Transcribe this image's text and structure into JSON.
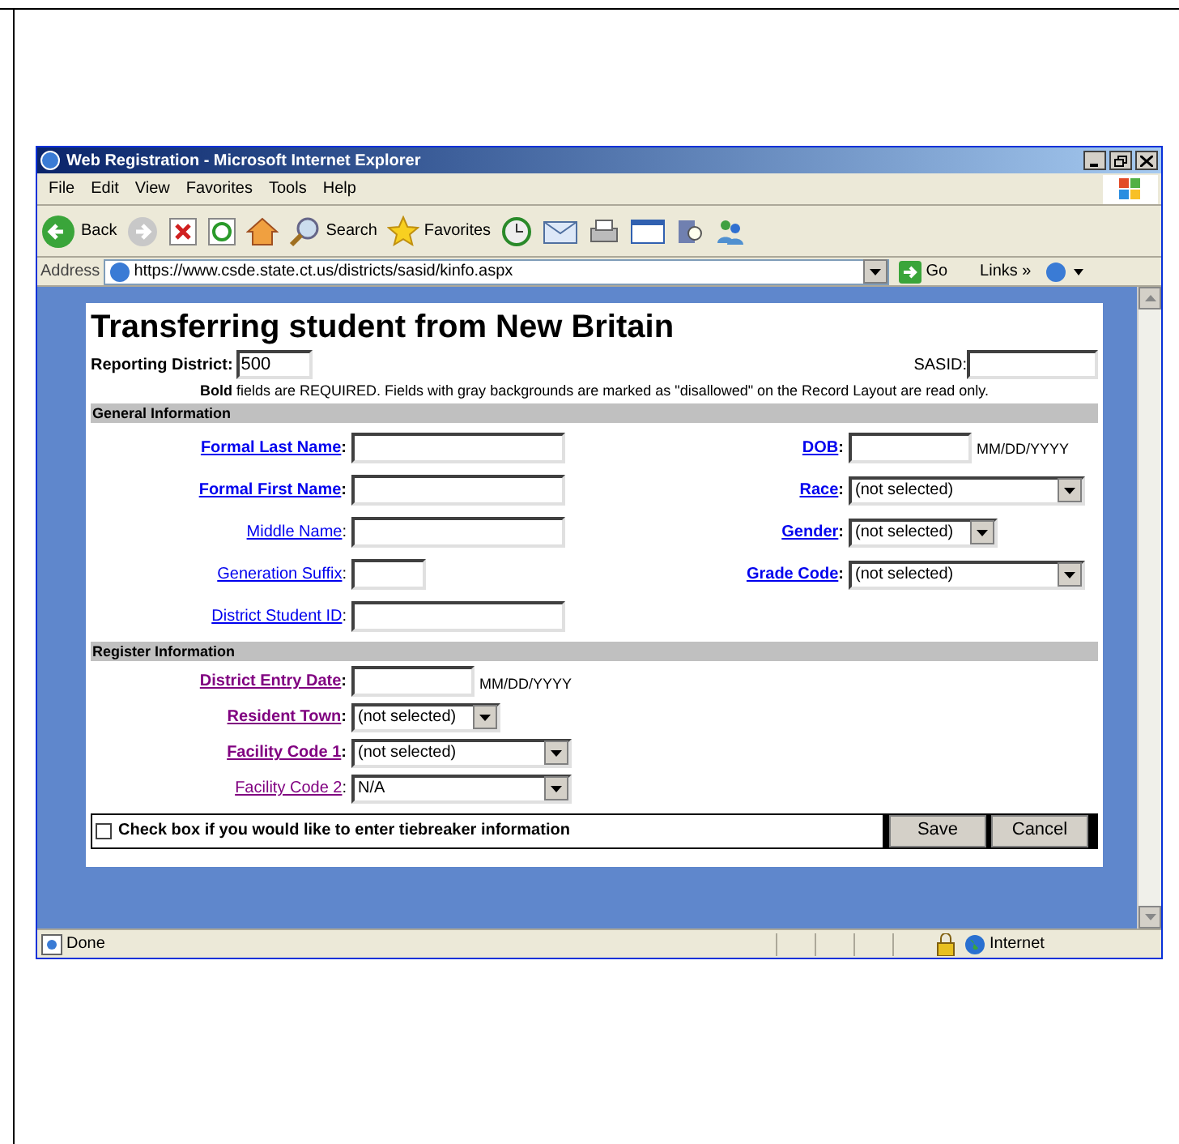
{
  "window": {
    "title": "Web Registration - Microsoft Internet Explorer"
  },
  "menu": [
    "File",
    "Edit",
    "View",
    "Favorites",
    "Tools",
    "Help"
  ],
  "toolbar": {
    "back": "Back",
    "search": "Search",
    "favorites": "Favorites"
  },
  "address": {
    "label": "Address",
    "url": "https://www.csde.state.ct.us/districts/sasid/kinfo.aspx",
    "go": "Go",
    "links": "Links",
    "chevron": "»"
  },
  "page": {
    "title": "Transferring student from New Britain",
    "reporting_district": {
      "label": "Reporting District:",
      "value": "500"
    },
    "sasid": {
      "label": "SASID:"
    },
    "note": "**Bold** fields are REQUIRED. Fields with gray backgrounds are marked as \"disallowed\" on the Record Layout are read only.",
    "sections": [
      {
        "title": "General Information",
        "columns": [
          [
            {
              "label": "Formal Last Name",
              "colon": ":",
              "required": true,
              "visited": false,
              "kind": "input"
            },
            {
              "label": "Formal First Name",
              "colon": ":",
              "required": true,
              "visited": false,
              "kind": "input"
            },
            {
              "label": "Middle Name",
              "colon": ":",
              "required": false,
              "visited": false,
              "kind": "input"
            },
            {
              "label": "Generation Suffix",
              "colon": ":",
              "required": false,
              "visited": false,
              "kind": "short"
            },
            {
              "label": "District Student ID",
              "colon": ":",
              "required": false,
              "visited": false,
              "kind": "input"
            }
          ],
          [
            {
              "label": "DOB",
              "colon": ":",
              "required": true,
              "visited": false,
              "kind": "input",
              "hint": "MM/DD/YYYY"
            },
            {
              "label": "Race",
              "colon": ":",
              "required": true,
              "visited": false,
              "kind": "select",
              "value": "(not selected)"
            },
            {
              "label": "Gender",
              "colon": ":",
              "required": true,
              "visited": false,
              "kind": "smallselect",
              "value": "(not selected)"
            },
            {
              "label": "Grade Code",
              "colon": ":",
              "required": true,
              "visited": false,
              "kind": "select",
              "value": "(not selected)"
            }
          ]
        ]
      },
      {
        "title": "Register Information",
        "columns": [
          [
            {
              "label": "District Entry Date",
              "colon": ":",
              "required": true,
              "visited": true,
              "kind": "input",
              "hint": "MM/DD/YYYY"
            },
            {
              "label": "Resident Town",
              "colon": ":",
              "required": true,
              "visited": true,
              "kind": "smallselect",
              "value": "(not selected)"
            },
            {
              "label": "Facility Code 1",
              "colon": ":",
              "required": true,
              "visited": true,
              "kind": "select",
              "value": "(not selected)"
            },
            {
              "label": "Facility Code 2",
              "colon": ":",
              "required": false,
              "visited": true,
              "kind": "select",
              "value": "N/A"
            }
          ]
        ]
      }
    ],
    "tiebreaker": {
      "label": "Check box if you would like to enter tiebreaker information",
      "checked": false
    },
    "buttons": [
      "Save",
      "Cancel"
    ]
  },
  "status_bar": {
    "text": "Done",
    "zone": "Internet"
  }
}
